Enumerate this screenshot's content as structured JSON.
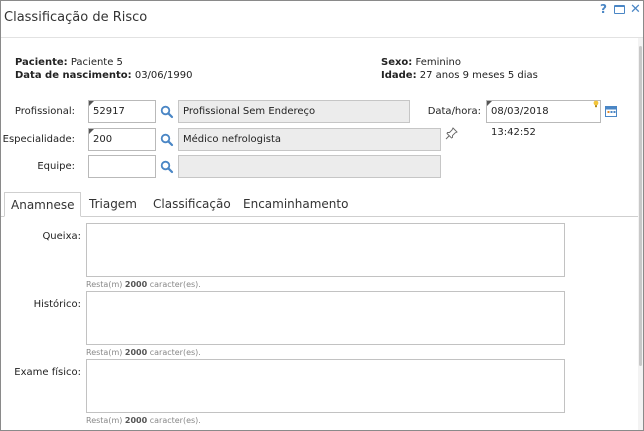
{
  "window": {
    "title": "Classificação de Risco"
  },
  "patient": {
    "name_label": "Paciente:",
    "name": "Paciente 5",
    "birth_label": "Data de nascimento:",
    "birth": "03/06/1990",
    "sex_label": "Sexo:",
    "sex": "Feminino",
    "age_label": "Idade:",
    "age": "27 anos 9 meses 5 dias"
  },
  "form": {
    "profissional": {
      "label": "Profissional:",
      "code": "52917",
      "name": "Profissional Sem Endereço"
    },
    "especialidade": {
      "label": "Especialidade:",
      "code": "200",
      "name": "Médico nefrologista"
    },
    "equipe": {
      "label": "Equipe:",
      "code": "",
      "name": ""
    },
    "datetime": {
      "label": "Data/hora:",
      "value": "08/03/2018 13:42:52"
    }
  },
  "tabs": [
    {
      "label": "Anamnese",
      "active": true
    },
    {
      "label": "Triagem",
      "active": false
    },
    {
      "label": "Classificação",
      "active": false
    },
    {
      "label": "Encaminhamento",
      "active": false
    }
  ],
  "anamnese": {
    "fields": [
      {
        "label": "Queixa:",
        "value": ""
      },
      {
        "label": "Histórico:",
        "value": ""
      },
      {
        "label": "Exame físico:",
        "value": ""
      }
    ],
    "remaining_prefix": "Resta(m)",
    "remaining_count": "2000",
    "remaining_suffix": "caracter(es)."
  },
  "icons": {
    "help": "help-icon",
    "maximize": "maximize-icon",
    "close": "close-icon",
    "search": "search-icon",
    "calendar": "calendar-icon",
    "pin": "pin-icon"
  },
  "colors": {
    "accent": "#4a86c5",
    "readonly_bg": "#ececec"
  }
}
